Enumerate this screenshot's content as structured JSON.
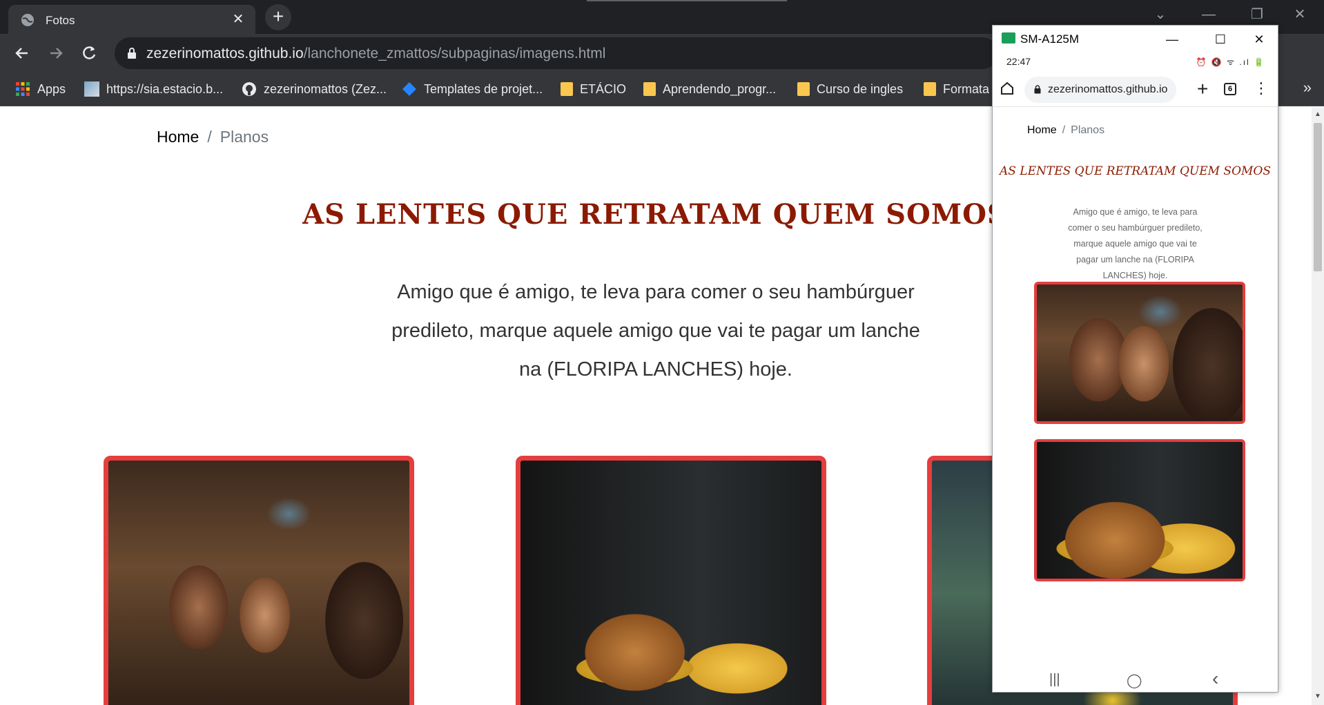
{
  "browser": {
    "tab_title": "Fotos",
    "tab_close": "✕",
    "new_tab": "+",
    "url_host": "zezerinomattos.github.io",
    "url_path": "/lanchonete_zmattos/subpaginas/imagens.html",
    "window_buttons": [
      "⌄",
      "—",
      "❐",
      "✕"
    ],
    "bookmarks": [
      {
        "label": "Apps",
        "icon": "apps-grid-icon"
      },
      {
        "label": "https://sia.estacio.b...",
        "icon": "site-icon"
      },
      {
        "label": "zezerinomattos (Zez...",
        "icon": "github-icon"
      },
      {
        "label": "Templates de projet...",
        "icon": "diamond-icon"
      },
      {
        "label": "ETÁCIO",
        "icon": "folder-icon"
      },
      {
        "label": "Aprendendo_progr...",
        "icon": "folder-icon"
      },
      {
        "label": "Curso de ingles",
        "icon": "folder-icon"
      },
      {
        "label": "Formata",
        "icon": "folder-icon"
      }
    ],
    "bookmarks_more": "»"
  },
  "page": {
    "breadcrumb": {
      "home": "Home",
      "separator": "/",
      "current": "Planos"
    },
    "heading": "AS LENTES QUE RETRATAM QUEM SOMOS",
    "intro": "Amigo que é amigo, te leva para comer o seu hambúrguer predileto, marque aquele amigo que vai te pagar um lanche na (FLORIPA LANCHES) hoje."
  },
  "phone": {
    "window_title": "SM-A125M",
    "time": "22:47",
    "status_icons": "⏰ 🔇 ᯤ .ıl 🔋",
    "url": "zezerinomattos.github.io",
    "tab_count": "6",
    "breadcrumb": {
      "home": "Home",
      "separator": "/",
      "current": "Planos"
    },
    "heading": "AS LENTES QUE RETRATAM QUEM SOMOS",
    "intro": "Amigo que é amigo, te leva para comer o seu hambúrguer predileto, marque aquele amigo que vai te pagar um lanche na (FLORIPA LANCHES) hoje.",
    "nav": {
      "recent": "|||",
      "home": "◯",
      "back": "‹"
    }
  },
  "colors": {
    "accent_red": "#e53e3e",
    "heading_brown": "#8b1a00",
    "chrome_dark": "#202124",
    "chrome_toolbar": "#35363a"
  }
}
